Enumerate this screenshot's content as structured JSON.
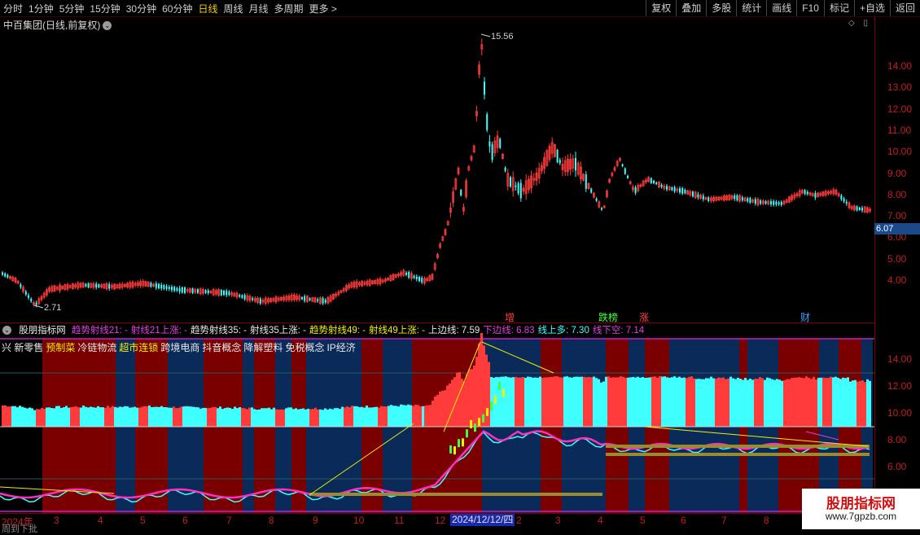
{
  "toolbar": {
    "periods": [
      "分时",
      "1分钟",
      "5分钟",
      "15分钟",
      "30分钟",
      "60分钟",
      "日线",
      "周线",
      "月线",
      "多周期",
      "更多 >"
    ],
    "active_period": "日线",
    "right_buttons": [
      "复权",
      "叠加",
      "多股",
      "统计",
      "画线",
      "F10",
      "标记",
      "+自选",
      "返回"
    ]
  },
  "stock": {
    "title": "中百集团(日线,前复权)"
  },
  "corner_icons": [
    "diamond-icon",
    "square-icon"
  ],
  "main_axis": [
    "14.00",
    "13.00",
    "12.00",
    "11.00",
    "10.00",
    "9.00",
    "8.00",
    "7.00",
    "6.00",
    "5.00",
    "4.00"
  ],
  "last_price": "6.07",
  "annotations": {
    "high": "15.56",
    "low": "2.71"
  },
  "markers": [
    {
      "text": "增",
      "color": "#ff4040"
    },
    {
      "text": "跌榜",
      "color": "#40ff40"
    },
    {
      "text": "涨",
      "color": "#ff4040"
    },
    {
      "text": "财",
      "color": "#40a0ff"
    }
  ],
  "indicator": {
    "name": "股朋指标网",
    "items": [
      {
        "text": "趋势射线21: -",
        "color": "#e040e0"
      },
      {
        "text": "射线21上涨: -",
        "color": "#e040e0"
      },
      {
        "text": "趋势射线35: -",
        "color": "#e8e8e8"
      },
      {
        "text": "射线35上涨: -",
        "color": "#e8e8e8"
      },
      {
        "text": "趋势射线49: -",
        "color": "#f0f000"
      },
      {
        "text": "射线49上涨: -",
        "color": "#f0f000"
      },
      {
        "text": "上边线: 7.59",
        "color": "#e8e8e8"
      },
      {
        "text": "下边线: 6.83",
        "color": "#e040e0"
      },
      {
        "text": "线上多: 7.30",
        "color": "#40ffff"
      },
      {
        "text": "线下空: 7.14",
        "color": "#e040e0"
      }
    ]
  },
  "concepts": [
    "兴 新零售",
    "预制菜",
    "冷链物流",
    "超市连锁",
    "跨境电商",
    "抖音概念",
    "降解塑料",
    "免税概念",
    "IP经济"
  ],
  "sub_axis": [
    "14.00",
    "12.00",
    "10.00",
    "8.00",
    "6.00"
  ],
  "dates": [
    "2024年",
    "3",
    "4",
    "5",
    "6",
    "7",
    "8",
    "9",
    "10",
    "11",
    "12",
    "2",
    "3",
    "4",
    "5",
    "6",
    "7",
    "8"
  ],
  "cursor_date": "2024/12/12/四",
  "bottom_hint": "周到下批",
  "watermark": {
    "title": "股朋指标网",
    "url": "www.7gpzb.com"
  },
  "colors": {
    "up": "#ff3b3b",
    "down": "#40ffff",
    "band_red": "#7a0000",
    "band_blue": "#0a2a5a"
  }
}
